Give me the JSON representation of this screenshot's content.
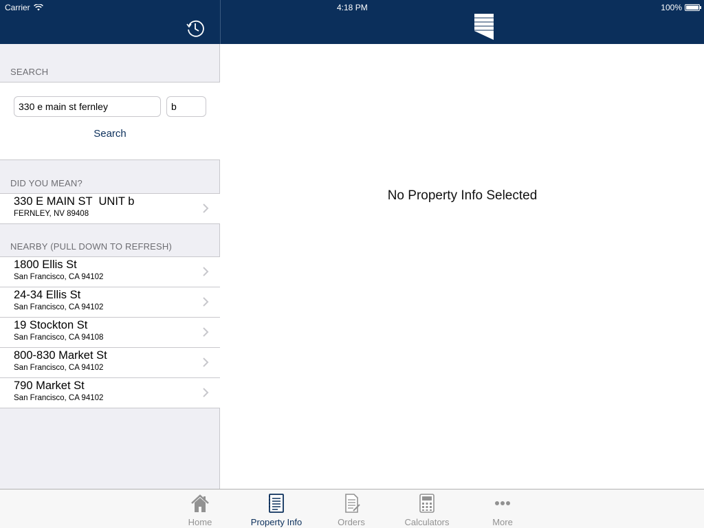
{
  "status_bar": {
    "carrier": "Carrier",
    "time": "4:18 PM",
    "battery": "100%"
  },
  "colors": {
    "nav": "#0b2f5b",
    "accent": "#0b2f5b",
    "group_bg": "#efeff4",
    "separator": "#c8c7cc",
    "tab_inactive": "#929292"
  },
  "icons": {
    "history": "history-clock-icon",
    "logo": "app-logo-icon",
    "chevron": "chevron-right-icon"
  },
  "search": {
    "header": "SEARCH",
    "address_value": "330 e main st fernley",
    "unit_value": "b",
    "button_label": "Search"
  },
  "did_you_mean": {
    "header": "DID YOU MEAN?",
    "items": [
      {
        "line1": "330 E MAIN ST  UNIT b",
        "line2": "FERNLEY, NV 89408"
      }
    ]
  },
  "nearby": {
    "header": "NEARBY (PULL DOWN TO REFRESH)",
    "items": [
      {
        "line1": "1800 Ellis St",
        "line2": "San Francisco, CA 94102"
      },
      {
        "line1": "24-34 Ellis St",
        "line2": "San Francisco, CA 94102"
      },
      {
        "line1": "19 Stockton St",
        "line2": "San Francisco, CA 94108"
      },
      {
        "line1": "800-830 Market St",
        "line2": "San Francisco, CA 94102"
      },
      {
        "line1": "790 Market St",
        "line2": "San Francisco, CA 94102"
      }
    ]
  },
  "detail": {
    "empty_message": "No Property Info Selected"
  },
  "tabs": [
    {
      "label": "Home",
      "icon": "home-icon",
      "active": false
    },
    {
      "label": "Property Info",
      "icon": "property-info-icon",
      "active": true
    },
    {
      "label": "Orders",
      "icon": "orders-icon",
      "active": false
    },
    {
      "label": "Calculators",
      "icon": "calculator-icon",
      "active": false
    },
    {
      "label": "More",
      "icon": "more-icon",
      "active": false
    }
  ]
}
